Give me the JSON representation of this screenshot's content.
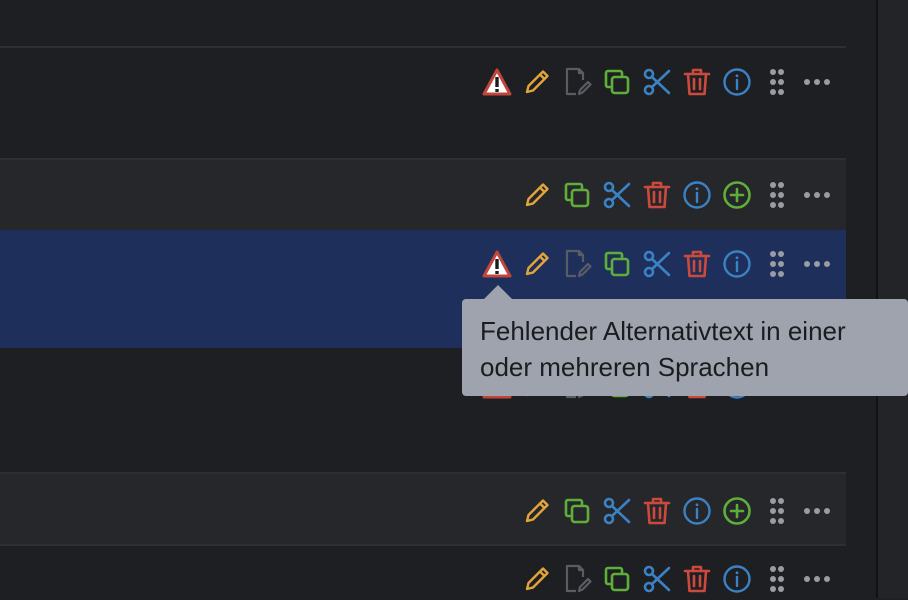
{
  "colors": {
    "background": "#1e1f22",
    "header_row": "#26272b",
    "selected_row": "#1f2f5c",
    "warning": "#c0453a",
    "edit": "#e3a43a",
    "copy": "#5fae3a",
    "cut": "#3b82c4",
    "delete": "#cc4a3c",
    "info": "#3b82c4",
    "add": "#5fae3a",
    "muted": "#5a5c63",
    "tooltip_bg": "#9ea3ad"
  },
  "icons": {
    "warning": "warning-triangle-icon",
    "edit": "pencil-icon",
    "edit_doc": "document-edit-icon",
    "copy": "copy-icon",
    "cut": "scissors-icon",
    "delete": "trash-icon",
    "info": "info-icon",
    "add": "plus-circle-icon",
    "drag": "drag-handle-icon",
    "more": "more-icon"
  },
  "tooltip": {
    "line1": "Fehlender Alternativtext in einer",
    "line2": "oder mehreren Sprachen"
  }
}
